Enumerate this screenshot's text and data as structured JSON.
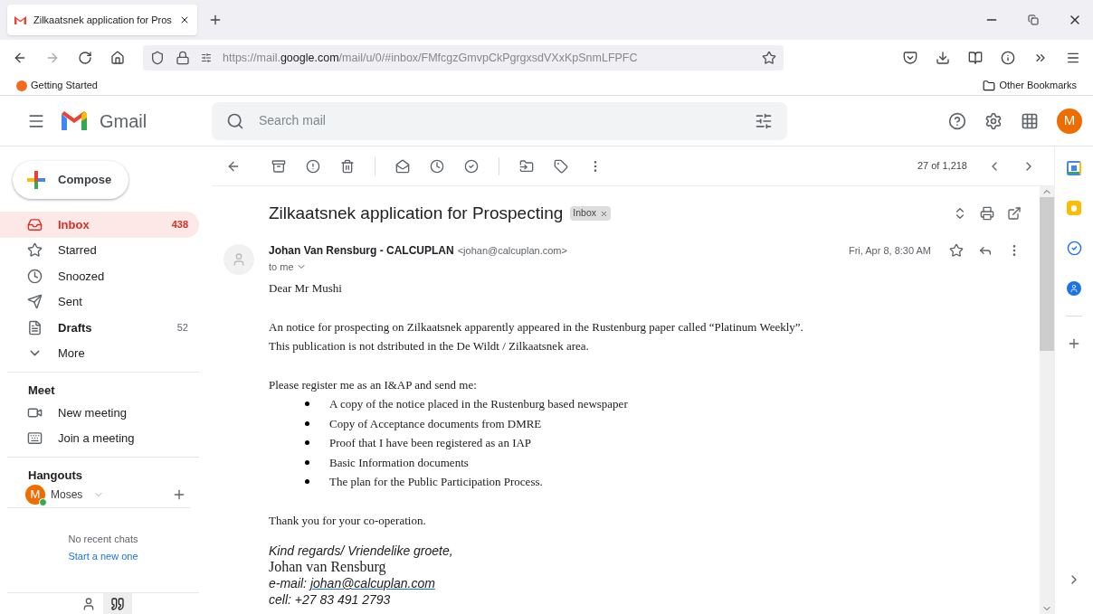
{
  "browser": {
    "tab": {
      "title": "Zilkaatsnek application for Pros"
    },
    "url": "https://mail.**google.com**/mail/u/0/#inbox/FMfcgzGmvpCkPgrgxsdVXxKpSnmLFPFC",
    "bookmarks": [
      "Getting Started"
    ],
    "other_bookmarks": "Other Bookmarks"
  },
  "header": {
    "app_name": "Gmail",
    "search": {
      "placeholder": "Search mail"
    },
    "avatar": "M"
  },
  "compose": "Compose",
  "nav": [
    {
      "kind": "inbox",
      "label": "Inbox",
      "count": "438",
      "selected": true,
      "bold": true
    },
    {
      "kind": "star",
      "label": "Starred",
      "selected": false,
      "bold": false
    },
    {
      "kind": "clock",
      "label": "Snoozed",
      "selected": false,
      "bold": false
    },
    {
      "kind": "send",
      "label": "Sent",
      "selected": false,
      "bold": false
    },
    {
      "kind": "file",
      "label": "Drafts",
      "count": "52",
      "selected": false,
      "bold": true
    },
    {
      "kind": "more",
      "label": "More",
      "selected": false,
      "bold": false
    }
  ],
  "meet": {
    "heading": "Meet",
    "items": [
      {
        "kind": "video",
        "label": "New meeting"
      },
      {
        "kind": "keyboard",
        "label": "Join a meeting"
      }
    ]
  },
  "hangouts": {
    "heading": "Hangouts",
    "user": {
      "avatar": "M",
      "name": "Moses",
      "online": true
    },
    "empty": "No recent chats",
    "link": "Start a new one"
  },
  "toolbar": {
    "counter": "27 of 1,218"
  },
  "email": {
    "subject": "Zilkaatsnek application for Prospecting",
    "label": "Inbox",
    "sender": "Johan Van Rensburg - CALCUPLAN",
    "sender_email": "<johan@calcuplan.com>",
    "to": "to me",
    "date": "Fri, Apr 8, 8:30 AM",
    "greeting": "Dear Mr Mushi",
    "paragraph": [
      "An notice for prospecting on Zilkaatsnek apparently appeared in the Rustenburg paper called “Platinum Weekly”.",
      "This publication is not dstributed in the De Wildt / Zilkaatsnek area."
    ],
    "request": "Please register me as an I&AP and send me:",
    "list": [
      "A copy of the notice placed in the Rustenburg based newspaper",
      "Copy of Acceptance documents from DMRE",
      "Proof that I have been registered as an IAP",
      "Basic Information documents",
      "The plan for the Public Participation Process."
    ],
    "thanks": "Thank you for your co-operation.",
    "signature": {
      "regards": "Kind regards/ Vriendelike groete,",
      "name": "Johan van Rensburg",
      "email_label": "e-mail:",
      "email": "johan@calcuplan.com",
      "cell": "cell: +27 83 491 2793"
    }
  }
}
